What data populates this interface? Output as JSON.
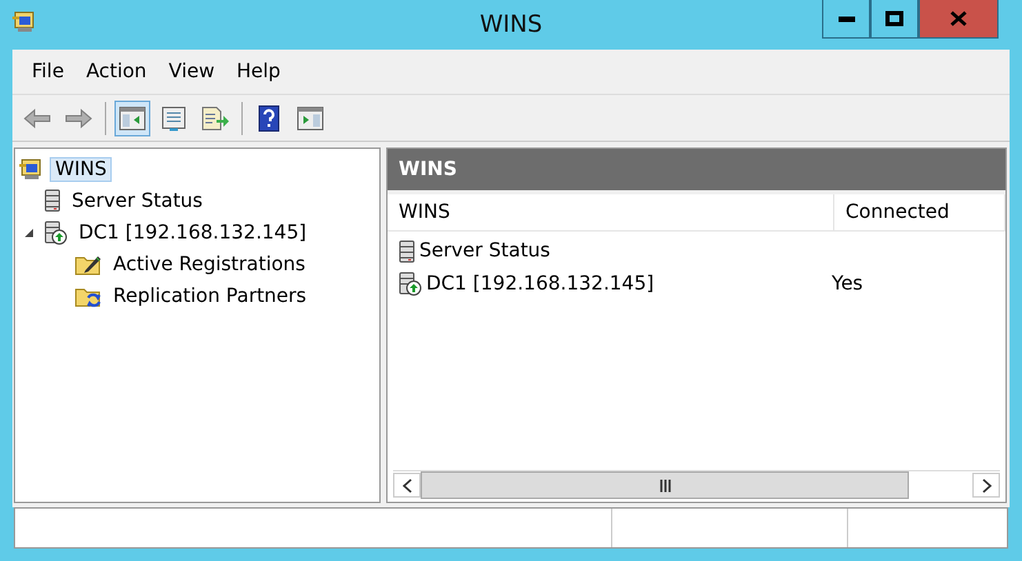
{
  "window": {
    "title": "WINS"
  },
  "menu": [
    "File",
    "Action",
    "View",
    "Help"
  ],
  "toolbar": [
    {
      "kind": "back",
      "disabled": true,
      "selected": false
    },
    {
      "kind": "forward",
      "disabled": true,
      "selected": false
    },
    {
      "kind": "tree",
      "disabled": false,
      "selected": true
    },
    {
      "kind": "properties",
      "disabled": false,
      "selected": false
    },
    {
      "kind": "export",
      "disabled": false,
      "selected": false
    },
    {
      "kind": "help",
      "disabled": false,
      "selected": false
    },
    {
      "kind": "action-pane",
      "disabled": false,
      "selected": false
    }
  ],
  "tree": [
    {
      "label": "WINS",
      "kind": "wins",
      "selected": true,
      "children": [
        {
          "label": "Server Status",
          "kind": "server",
          "selected": false
        },
        {
          "label": "DC1 [192.168.132.145]",
          "kind": "dc",
          "selected": false,
          "expanded": true,
          "children": [
            {
              "label": "Active Registrations",
              "kind": "folder-edit",
              "selected": false
            },
            {
              "label": "Replication Partners",
              "kind": "folder-sync",
              "selected": false
            }
          ]
        }
      ]
    }
  ],
  "details": {
    "title": "WINS",
    "columns": [
      "WINS",
      "Connected"
    ],
    "rows": [
      {
        "name": "Server Status",
        "kind": "server"
      },
      {
        "name": "DC1 [192.168.132.145]",
        "kind": "dc",
        "connected": "Yes"
      }
    ]
  }
}
